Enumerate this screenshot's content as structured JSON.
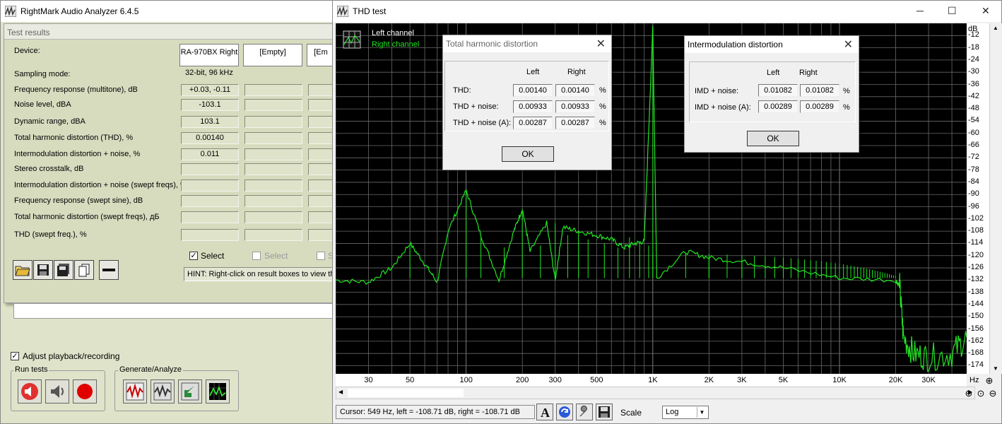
{
  "main_window": {
    "title": "RightMark Audio Analyzer 6.4.5",
    "panel_title": "Test results",
    "device_label": "Device:",
    "devices": [
      "RA-970BX Right",
      "[Empty]",
      "[Em"
    ],
    "rows": [
      {
        "label": "Sampling mode:",
        "value": "32-bit, 96 kHz"
      },
      {
        "label": "Frequency response (multitone), dB",
        "value": "+0.03, -0.11"
      },
      {
        "label": "Noise level, dBA",
        "value": "-103.1"
      },
      {
        "label": "Dynamic range, dBA",
        "value": "103.1"
      },
      {
        "label": "Total harmonic distortion (THD), %",
        "value": "0.00140"
      },
      {
        "label": "Intermodulation distortion + noise, %",
        "value": "0.011"
      },
      {
        "label": "Stereo crosstalk, dB",
        "value": ""
      },
      {
        "label": "Intermodulation distortion + noise (swept freqs), %",
        "value": ""
      },
      {
        "label": "Frequency response (swept sine), dB",
        "value": ""
      },
      {
        "label": "Total harmonic distortion (swept freqs), дБ",
        "value": ""
      },
      {
        "label": "THD (swept freq.), %",
        "value": ""
      }
    ],
    "select_labels": [
      "Select",
      "Select",
      "S"
    ],
    "hint": "HINT: Right-click on result boxes to view the",
    "adjust_label": "Adjust playback/recording",
    "run_tests_label": "Run tests",
    "generate_label": "Generate/Analyze"
  },
  "thd_window": {
    "title": "THD test",
    "legend_left": "Left channel",
    "legend_right": "Right channel",
    "status": "Cursor:  549 Hz,  left = -108.71 dB,  right = -108.71 dB",
    "scale_label": "Scale",
    "scale_value": "Log",
    "y_unit": "dB",
    "x_unit": "Hz"
  },
  "thd_dialog": {
    "title": "Total harmonic distortion",
    "col_left": "Left",
    "col_right": "Right",
    "rows": [
      {
        "label": "THD:",
        "left": "0.00140",
        "right": "0.00140",
        "unit": "%"
      },
      {
        "label": "THD + noise:",
        "left": "0.00933",
        "right": "0.00933",
        "unit": "%"
      },
      {
        "label": "THD + noise (A):",
        "left": "0.00287",
        "right": "0.00287",
        "unit": "%"
      }
    ],
    "ok": "OK"
  },
  "imd_dialog": {
    "title": "Intermodulation distortion",
    "col_left": "Left",
    "col_right": "Right",
    "rows": [
      {
        "label": "IMD + noise:",
        "left": "0.01082",
        "right": "0.01082",
        "unit": "%"
      },
      {
        "label": "IMD + noise (A):",
        "left": "0.00289",
        "right": "0.00289",
        "unit": "%"
      }
    ],
    "ok": "OK"
  },
  "chart_data": {
    "type": "line",
    "ylabel": "dB",
    "xlabel": "Hz",
    "x_scale": "log",
    "xlim": [
      20,
      48000
    ],
    "ylim": [
      -178,
      -6
    ],
    "y_ticks": [
      -12,
      -18,
      -24,
      -30,
      -36,
      -42,
      -48,
      -54,
      -60,
      -66,
      -72,
      -78,
      -84,
      -90,
      -96,
      -102,
      -108,
      -114,
      -120,
      -126,
      -132,
      -138,
      -144,
      -150,
      -156,
      -162,
      -168,
      -174
    ],
    "x_ticks": [
      30,
      50,
      100,
      200,
      300,
      500,
      1000,
      2000,
      3000,
      5000,
      10000,
      20000,
      30000
    ],
    "x_tick_labels": [
      "30",
      "50",
      "100",
      "200",
      "300",
      "500",
      "1K",
      "2K",
      "3K",
      "5K",
      "10K",
      "20K",
      "30K"
    ],
    "grid": true,
    "series": [
      {
        "name": "Left channel",
        "color": "#ffffff",
        "points": []
      },
      {
        "name": "Right channel",
        "color": "#22e622",
        "points": [
          [
            20,
            -132
          ],
          [
            30,
            -133
          ],
          [
            40,
            -126
          ],
          [
            50,
            -114
          ],
          [
            60,
            -124
          ],
          [
            70,
            -133
          ],
          [
            80,
            -108
          ],
          [
            100,
            -88
          ],
          [
            120,
            -110
          ],
          [
            150,
            -132
          ],
          [
            180,
            -108
          ],
          [
            200,
            -97
          ],
          [
            220,
            -118
          ],
          [
            270,
            -104
          ],
          [
            300,
            -132
          ],
          [
            330,
            -106
          ],
          [
            400,
            -108
          ],
          [
            500,
            -110
          ],
          [
            600,
            -112
          ],
          [
            700,
            -116
          ],
          [
            800,
            -114
          ],
          [
            900,
            -113
          ],
          [
            1000,
            -8
          ],
          [
            1050,
            -131
          ],
          [
            1500,
            -118
          ],
          [
            2000,
            -121
          ],
          [
            3000,
            -123
          ],
          [
            5000,
            -126
          ],
          [
            10000,
            -131
          ],
          [
            20000,
            -132
          ],
          [
            21000,
            -135
          ],
          [
            22000,
            -160
          ],
          [
            25000,
            -168
          ],
          [
            30000,
            -170
          ],
          [
            40000,
            -168
          ],
          [
            48000,
            -160
          ]
        ]
      }
    ],
    "peaks": [
      [
        50,
        -114
      ],
      [
        100,
        -88
      ],
      [
        200,
        -97
      ],
      [
        300,
        -104
      ],
      [
        400,
        -108
      ],
      [
        1000,
        -8
      ],
      [
        2000,
        -120
      ],
      [
        3000,
        -122
      ]
    ]
  }
}
